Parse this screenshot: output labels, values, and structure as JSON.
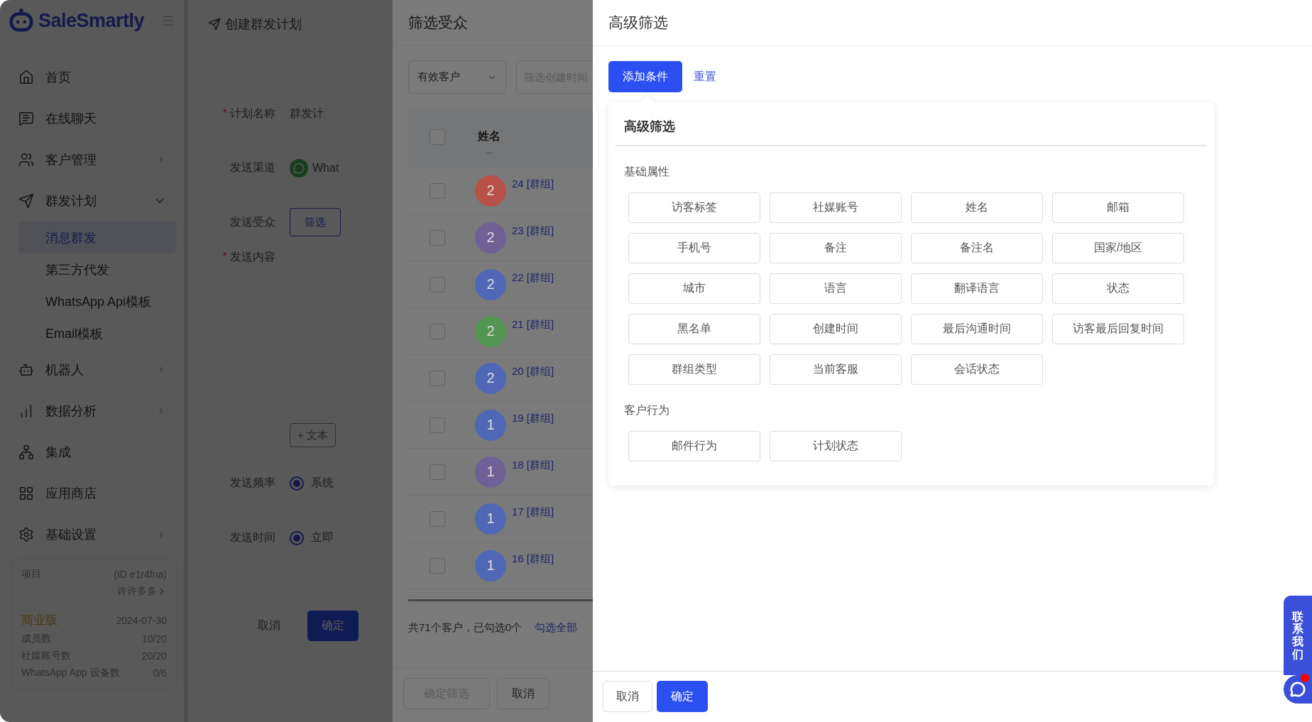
{
  "brand": {
    "name": "SaleSmartly"
  },
  "sidebar": {
    "items": [
      {
        "label": "首页",
        "selected": false
      },
      {
        "label": "在线聊天",
        "selected": false
      },
      {
        "label": "客户管理",
        "selected": false,
        "expanded": false
      },
      {
        "label": "群发计划",
        "selected": false,
        "expanded": true,
        "children": [
          {
            "label": "消息群发",
            "selected": true
          },
          {
            "label": "第三方代发",
            "selected": false
          },
          {
            "label": "WhatsApp Api模板",
            "selected": false
          },
          {
            "label": "Email模板",
            "selected": false
          }
        ]
      },
      {
        "label": "机器人",
        "selected": false,
        "expanded": false
      },
      {
        "label": "数据分析",
        "selected": false,
        "expanded": false
      },
      {
        "label": "集成",
        "selected": false
      },
      {
        "label": "应用商店",
        "selected": false
      },
      {
        "label": "基础设置",
        "selected": false,
        "expanded": false
      }
    ],
    "project": {
      "label": "项目",
      "id": "(ID e1r4fna)",
      "name": "许许多多"
    },
    "plan": {
      "name": "商业版",
      "date": "2024-07-30",
      "stats": [
        {
          "label": "成员数",
          "value": "10/20"
        },
        {
          "label": "社媒账号数",
          "value": "20/20"
        },
        {
          "label": "WhatsApp App 设备数",
          "value": "0/6"
        }
      ]
    }
  },
  "page": {
    "title": "创建群发计划",
    "required_mark": "*",
    "fields": [
      {
        "kind": "text",
        "label": "计划名称",
        "required": true,
        "value": "群发计"
      },
      {
        "kind": "channel",
        "label": "发送渠道",
        "required": false,
        "value": "What"
      },
      {
        "kind": "button",
        "label": "发送受众",
        "required": false,
        "button": "筛选"
      },
      {
        "kind": "content",
        "label": "发送内容",
        "required": true,
        "button": "+ 文本"
      },
      {
        "kind": "radio",
        "label": "发送频率",
        "required": false,
        "option": "系统",
        "selected": true
      },
      {
        "kind": "radio",
        "label": "发送时间",
        "required": false,
        "option": "立即",
        "selected": true
      }
    ],
    "cancel": "取消",
    "confirm": "确定"
  },
  "audience": {
    "title": "筛选受众",
    "select": "有效客户",
    "date_placeholder": "筛选创建时间",
    "columns": [
      "姓名"
    ],
    "header_checked": false,
    "header_dash": "—",
    "rows": [
      {
        "avatar": "2",
        "color": "#b8514a",
        "name": "24 [群组]",
        "checked": false
      },
      {
        "avatar": "2",
        "color": "#6f6096",
        "name": "23 [群组]",
        "checked": false
      },
      {
        "avatar": "2",
        "color": "#4f67b5",
        "name": "22 [群组]",
        "checked": false
      },
      {
        "avatar": "2",
        "color": "#529652",
        "name": "21 [群组]",
        "checked": false
      },
      {
        "avatar": "2",
        "color": "#4f67b5",
        "name": "20 [群组]",
        "checked": false
      },
      {
        "avatar": "1",
        "color": "#4f67b5",
        "name": "19 [群组]",
        "checked": false
      },
      {
        "avatar": "1",
        "color": "#6f6096",
        "name": "18 [群组]",
        "checked": false
      },
      {
        "avatar": "1",
        "color": "#4f67b5",
        "name": "17 [群组]",
        "checked": false
      },
      {
        "avatar": "1",
        "color": "#4f67b5",
        "name": "16 [群组]",
        "checked": false
      }
    ],
    "summary": "共71个客户，已勾选0个",
    "select_all": "勾选全部",
    "confirm": "确定筛选",
    "confirm_disabled": true,
    "cancel": "取消"
  },
  "advanced": {
    "title": "高级筛选",
    "add": "添加条件",
    "reset": "重置",
    "popover": {
      "title": "高级筛选",
      "groups": [
        {
          "title": "基础属性",
          "options": [
            "访客标签",
            "社媒账号",
            "姓名",
            "邮箱",
            "手机号",
            "备注",
            "备注名",
            "国家/地区",
            "城市",
            "语言",
            "翻译语言",
            "状态",
            "黑名单",
            "创建时间",
            "最后沟通时间",
            "访客最后回复时间",
            "群组类型",
            "当前客服",
            "会话状态"
          ]
        },
        {
          "title": "客户行为",
          "options": [
            "邮件行为",
            "计划状态"
          ]
        }
      ]
    },
    "cancel": "取消",
    "confirm": "确定"
  },
  "contact": {
    "label": "联系我们",
    "unread": true
  }
}
